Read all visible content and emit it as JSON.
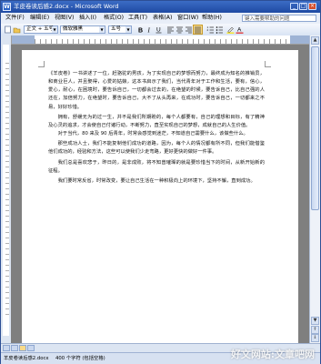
{
  "window": {
    "title": "羊皮卷读后感2.docx - Microsoft Word",
    "app_icon": "W",
    "minimize_icon": "minimize-icon",
    "maximize_icon": "maximize-icon",
    "close_icon": "close-icon"
  },
  "menu": {
    "items": [
      "文件(F)",
      "编辑(E)",
      "视图(V)",
      "插入(I)",
      "格式(O)",
      "工具(T)",
      "表格(A)",
      "窗口(W)",
      "帮助(H)"
    ],
    "help_placeholder": "键入需要帮助的问题"
  },
  "toolbar": {
    "style_value": "正文 + 五号",
    "font_value": "微软雅黑",
    "size_value": "五号",
    "icons": [
      "new-icon",
      "open-icon",
      "save-icon",
      "print-icon",
      "undo-icon",
      "bold-icon",
      "italic-icon",
      "underline-icon",
      "align-left-icon",
      "align-center-icon",
      "align-right-icon",
      "justify-icon",
      "font-color-icon"
    ]
  },
  "document": {
    "paragraphs": [
      "《羊皮卷》一书讲述了一位，赶骆驼的男孩，为了实现自己的梦想而努力，最终成为知名的推销员，和商业巨人，并且娶得，心爱的姑娘，这本书启示了我们，当代青年对于工作和生活，要有，信心，爱心，耐心，在困境时，要告诉自己，一切都会过去的，在绝望的时候，要告诉自己，比自己强的人还在，加倍努力，在绝望时，要告诉自己，大不了从头再来，在成功时，要告诉自己，一切都来之不易，好好珍惜。",
      "拥有，舒缓无为的过一生，并不是我们所期盼的，每个人都要有，自己的理想和目标，有了精神及心灵的追求，才会使自己付诸行动，不断努力，直至实现自己的梦想，成就自己的人生价值。",
      "对于当代，80 来及 90 后青年，时常会感觉到迷茫，不知道自己需要什么，该做些什么。",
      "那些成功人士，我们不能复制他们成功的道路，因为，每个人的情况都有所不同，但我们能借鉴他们成功的，经验和方法，这些可以使我们少走弯路，更好更快的做好一件事。",
      "我们总是喜欢悲于，昨日的，是非成败，将不知曾璀璨的就是要珍惜当下的时间，从新开始新的征程。",
      "我们要时常反省，时常改变，要让自己生活在一种积极向上的环境下，坚持不懈，直到成功。"
    ]
  },
  "status": {
    "page_info": "羊皮卷读后感2.docx",
    "word_count": "400 个字符 (包括空格)",
    "extra": ""
  },
  "watermark": "好文网站:文章吧网",
  "colors": {
    "titlebar": "#1f4aa3",
    "menubar": "#e8eef8",
    "workspace": "#7f7f7f"
  }
}
